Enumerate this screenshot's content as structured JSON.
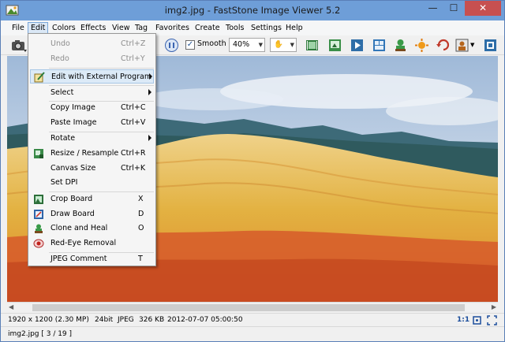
{
  "window": {
    "title": "img2.jpg  -  FastStone Image Viewer 5.2",
    "minimize_glyph": "—",
    "maximize_glyph": "☐",
    "close_glyph": "✕"
  },
  "menubar": {
    "items": [
      "File",
      "Edit",
      "Colors",
      "Effects",
      "View",
      "Tag",
      "Favorites",
      "Create",
      "Tools",
      "Settings",
      "Help"
    ],
    "active": "Edit"
  },
  "toolbar": {
    "smooth_label": "Smooth",
    "smooth_checked": true,
    "zoom_value": "40%",
    "checkmark_glyph": "✓",
    "dropdown_glyph": "▼",
    "hand_glyph": "✋"
  },
  "edit_menu": {
    "items": [
      {
        "label": "Undo",
        "shortcut": "Ctrl+Z",
        "disabled": true
      },
      {
        "label": "Redo",
        "shortcut": "Ctrl+Y",
        "disabled": true
      },
      {
        "label": "Edit with External Program",
        "shortcut": "",
        "submenu": true,
        "icon": "external-program-icon",
        "highlighted": true
      },
      {
        "label": "Select",
        "shortcut": "",
        "submenu": true
      },
      {
        "label": "Copy Image",
        "shortcut": "Ctrl+C"
      },
      {
        "label": "Paste Image",
        "shortcut": "Ctrl+V"
      },
      {
        "label": "Rotate",
        "shortcut": "",
        "submenu": true
      },
      {
        "label": "Resize / Resample",
        "shortcut": "Ctrl+R",
        "icon": "resize-icon"
      },
      {
        "label": "Canvas Size",
        "shortcut": "Ctrl+K"
      },
      {
        "label": "Set DPI",
        "shortcut": ""
      },
      {
        "label": "Crop Board",
        "shortcut": "X",
        "icon": "crop-board-icon"
      },
      {
        "label": "Draw Board",
        "shortcut": "D",
        "icon": "draw-board-icon"
      },
      {
        "label": "Clone and Heal",
        "shortcut": "O",
        "icon": "clone-heal-icon"
      },
      {
        "label": "Red-Eye Removal",
        "shortcut": "",
        "icon": "red-eye-icon"
      },
      {
        "label": "JPEG Comment",
        "shortcut": "T"
      }
    ]
  },
  "status": {
    "dimensions": "1920 x 1200 (2.30 MP)",
    "bit_depth": "24bit",
    "format": "JPEG",
    "file_size": "326 KB",
    "datetime": "2012-07-07 05:00:50",
    "scale": "1:1",
    "file_position": "img2.jpg [ 3 / 19 ]"
  },
  "scrollbar": {
    "left_glyph": "◀",
    "right_glyph": "▶"
  },
  "colors": {
    "titlebar": "#6e9ed8",
    "close_button": "#c75050",
    "menu_highlight": "#dceaf7",
    "sky": "#c9d7e8",
    "hills_yellow": "#e3b242",
    "hills_red": "#d9592a"
  }
}
